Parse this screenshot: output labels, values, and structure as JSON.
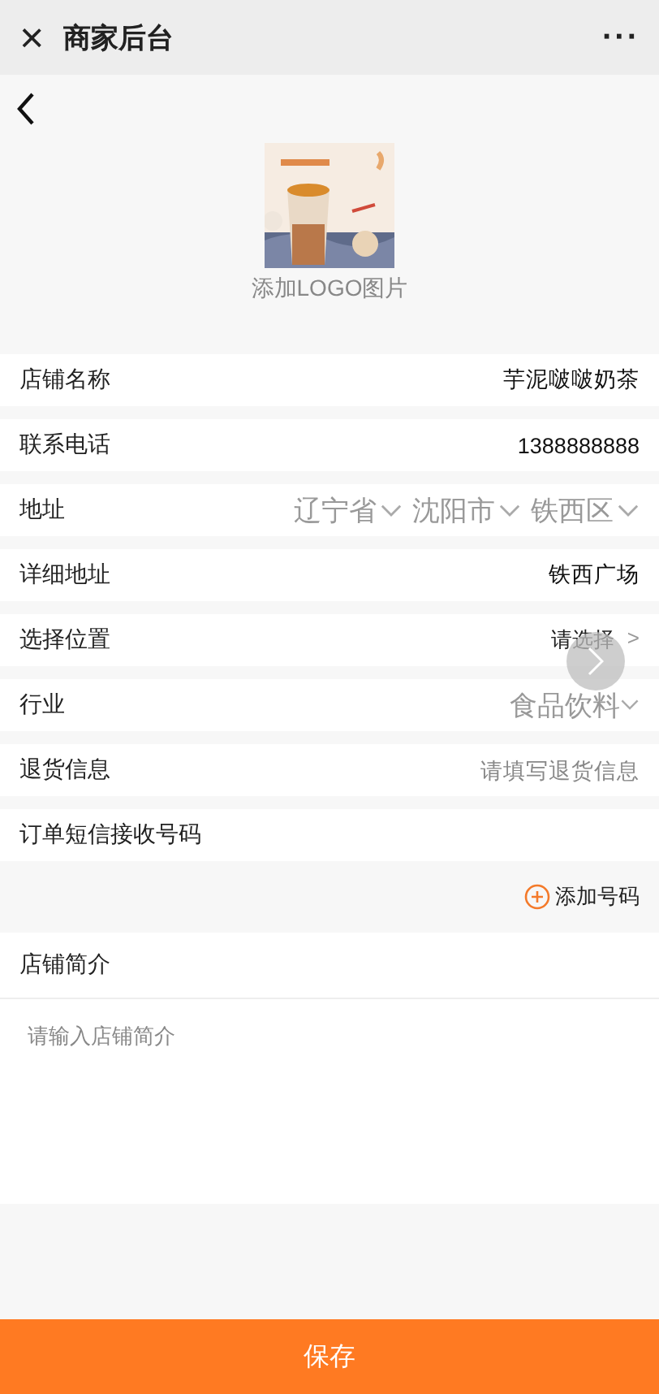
{
  "header": {
    "title": "商家后台",
    "close_icon": "×",
    "more": "···"
  },
  "logo": {
    "kind": "picture",
    "caption": "添加LOGO图片"
  },
  "rows": [
    {
      "label": "店铺名称",
      "kind": "value",
      "value": "芋泥啵啵奶茶"
    },
    {
      "label": "联系电话",
      "kind": "value",
      "value": "1388888888"
    },
    {
      "label": "地址",
      "kind": "region",
      "regions": [
        "辽宁省",
        "沈阳市",
        "铁西区"
      ]
    },
    {
      "label": "详细地址",
      "kind": "value",
      "value": "铁西广场"
    },
    {
      "label": "选择位置",
      "kind": "picker",
      "value": "请选择",
      "arrow": ">"
    },
    {
      "label": "行业",
      "kind": "dropdown",
      "value": "食品饮料"
    },
    {
      "label": "退货信息",
      "kind": "input",
      "placeholder": "请填写退货信息"
    },
    {
      "label": "订单短信接收号码",
      "kind": "label"
    }
  ],
  "add_phone": {
    "label": "添加号码"
  },
  "intro": {
    "label": "店铺简介",
    "placeholder": "请输入店铺简介"
  },
  "save_button": {
    "label": "保存"
  }
}
